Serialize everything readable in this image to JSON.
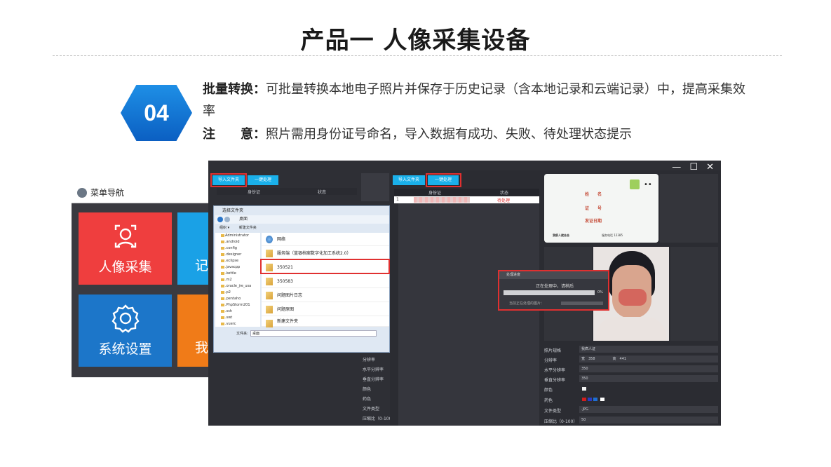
{
  "title": "产品一  人像采集设备",
  "badge": "04",
  "desc": {
    "line1_label": "批量转换：",
    "line1_text": "可批量转换本地电子照片并保存于历史记录（含本地记录和云端记录）中，提高采集效率",
    "line2_label": "注　　意：",
    "line2_text": "照片需用身份证号命名，导入数据有成功、失败、待处理状态提示"
  },
  "menu": {
    "header": "菜单导航",
    "tiles": [
      {
        "label": "人像采集",
        "icon": "user-face-icon",
        "color": "#ef3e3e"
      },
      {
        "label": "记",
        "icon": "",
        "color": "#1aa1e6"
      },
      {
        "label": "系统设置",
        "icon": "gear-icon",
        "color": "#1c76c9"
      },
      {
        "label": "我",
        "icon": "",
        "color": "#f07b18"
      }
    ]
  },
  "app": {
    "window_controls": "— ☐ ✕",
    "left": {
      "import_btn": "导入文件夹",
      "process_btn": "一键处理",
      "col_id": "身份证",
      "col_status": "状态",
      "props": [
        "分辨率",
        "水平分辨率",
        "垂直分辨率",
        "颜色",
        "药色",
        "文件类型",
        "压缩比（0-100）"
      ]
    },
    "dialog": {
      "title": "选择文件夹",
      "address": "桌面",
      "toolbar_org": "组织 ▾",
      "toolbar_new": "新建文件夹",
      "tree": [
        "Administrator",
        ".android",
        ".config",
        ".designer",
        ".eclipse",
        ".javacpp",
        ".kettle",
        ".m2",
        ".oracle_jre_usa",
        ".p2",
        ".pentaho",
        ".PhpStorm201",
        ".ssh",
        ".swt",
        ".vuerc"
      ],
      "items": [
        "网络",
        "服务端（蓝银档案数字化加工系统2.0）",
        "350521",
        "350583",
        "问题图片日志",
        "问题原图",
        "新建文件夹"
      ],
      "folder_label": "文件夹:",
      "folder_value": "桌面"
    },
    "right": {
      "import_btn": "导入文件夹",
      "process_btn": "一键处理",
      "col_id": "身份证",
      "col_status": "状态",
      "row_num": "1",
      "row_status": "待处理",
      "card_name": "姓　　名",
      "card_id": "证　　号",
      "card_date": "发证日期",
      "card_footer_left": "我疯人就合合",
      "card_footer_right": "服务电话 12385",
      "progress_title": "处理进度",
      "progress_msg": "正在处理中，请稍后",
      "progress_pct": "0%",
      "progress_current": "当前正在处理的图片：",
      "props": [
        {
          "label": "照片规格",
          "value": "我疯人证"
        },
        {
          "label": "分辨率",
          "value": "宽　358　　　　　高　441"
        },
        {
          "label": "水平分辨率",
          "value": "350"
        },
        {
          "label": "垂直分辨率",
          "value": "350"
        },
        {
          "label": "颜色",
          "value": ""
        },
        {
          "label": "药色",
          "value": ""
        },
        {
          "label": "文件类型",
          "value": ".JPG"
        },
        {
          "label": "压缩比（0-100）",
          "value": "50"
        }
      ]
    }
  }
}
